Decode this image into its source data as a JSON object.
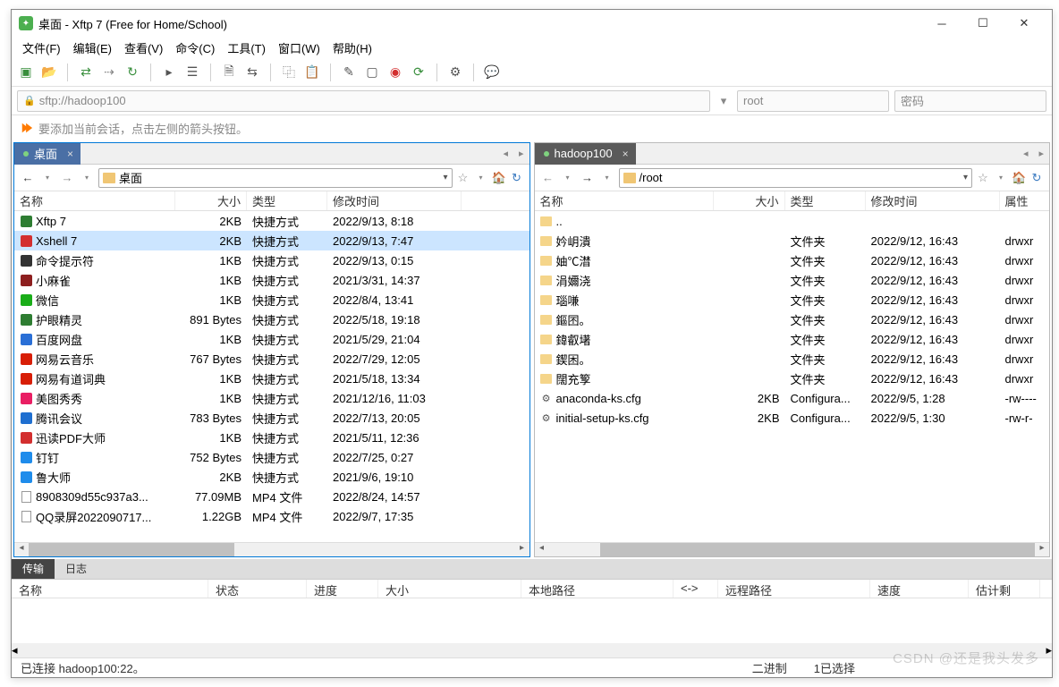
{
  "title": "桌面 - Xftp 7 (Free for Home/School)",
  "menus": [
    "文件(F)",
    "编辑(E)",
    "查看(V)",
    "命令(C)",
    "工具(T)",
    "窗口(W)",
    "帮助(H)"
  ],
  "address": {
    "url": "sftp://hadoop100",
    "user": "root",
    "pass_placeholder": "密码"
  },
  "hint": "要添加当前会话，点击左侧的箭头按钮。",
  "left": {
    "tab": "桌面",
    "path": "桌面",
    "columns": [
      "名称",
      "大小",
      "类型",
      "修改时间"
    ],
    "rows": [
      {
        "name": "Xftp 7",
        "size": "2KB",
        "type": "快捷方式",
        "date": "2022/9/13, 8:18",
        "ico": "app",
        "c": "#2e7d32"
      },
      {
        "name": "Xshell 7",
        "size": "2KB",
        "type": "快捷方式",
        "date": "2022/9/13, 7:47",
        "ico": "app",
        "c": "#d32f2f",
        "sel": true
      },
      {
        "name": "命令提示符",
        "size": "1KB",
        "type": "快捷方式",
        "date": "2022/9/13, 0:15",
        "ico": "app",
        "c": "#333"
      },
      {
        "name": "小麻雀",
        "size": "1KB",
        "type": "快捷方式",
        "date": "2021/3/31, 14:37",
        "ico": "app",
        "c": "#8d1f1f"
      },
      {
        "name": "微信",
        "size": "1KB",
        "type": "快捷方式",
        "date": "2022/8/4, 13:41",
        "ico": "app",
        "c": "#1aad19"
      },
      {
        "name": "护眼精灵",
        "size": "891 Bytes",
        "type": "快捷方式",
        "date": "2022/5/18, 19:18",
        "ico": "app",
        "c": "#2e7d32"
      },
      {
        "name": "百度网盘",
        "size": "1KB",
        "type": "快捷方式",
        "date": "2021/5/29, 21:04",
        "ico": "app",
        "c": "#2a6fd6"
      },
      {
        "name": "网易云音乐",
        "size": "767 Bytes",
        "type": "快捷方式",
        "date": "2022/7/29, 12:05",
        "ico": "app",
        "c": "#d81e06"
      },
      {
        "name": "网易有道词典",
        "size": "1KB",
        "type": "快捷方式",
        "date": "2021/5/18, 13:34",
        "ico": "app",
        "c": "#d81e06"
      },
      {
        "name": "美图秀秀",
        "size": "1KB",
        "type": "快捷方式",
        "date": "2021/12/16, 11:03",
        "ico": "app",
        "c": "#e91e63"
      },
      {
        "name": "腾讯会议",
        "size": "783 Bytes",
        "type": "快捷方式",
        "date": "2022/7/13, 20:05",
        "ico": "app",
        "c": "#1f6fd0"
      },
      {
        "name": "迅读PDF大师",
        "size": "1KB",
        "type": "快捷方式",
        "date": "2021/5/11, 12:36",
        "ico": "app",
        "c": "#d32f2f"
      },
      {
        "name": "钉钉",
        "size": "752 Bytes",
        "type": "快捷方式",
        "date": "2022/7/25, 0:27",
        "ico": "app",
        "c": "#1f8ceb"
      },
      {
        "name": "鲁大师",
        "size": "2KB",
        "type": "快捷方式",
        "date": "2021/9/6, 19:10",
        "ico": "app",
        "c": "#1f8ceb"
      },
      {
        "name": "8908309d55c937a3...",
        "size": "77.09MB",
        "type": "MP4 文件",
        "date": "2022/8/24, 14:57",
        "ico": "file",
        "c": "#4a90d9"
      },
      {
        "name": "QQ录屏2022090717...",
        "size": "1.22GB",
        "type": "MP4 文件",
        "date": "2022/9/7, 17:35",
        "ico": "file",
        "c": "#4a90d9"
      }
    ]
  },
  "right": {
    "tab": "hadoop100",
    "path": "/root",
    "columns": [
      "名称",
      "大小",
      "类型",
      "修改时间",
      "属性"
    ],
    "rows": [
      {
        "name": "..",
        "size": "",
        "type": "",
        "date": "",
        "attr": "",
        "ico": "folder"
      },
      {
        "name": "妗岄潰",
        "size": "",
        "type": "文件夹",
        "date": "2022/9/12, 16:43",
        "attr": "drwxr",
        "ico": "folder"
      },
      {
        "name": "妯℃澘",
        "size": "",
        "type": "文件夹",
        "date": "2022/9/12, 16:43",
        "attr": "drwxr",
        "ico": "folder"
      },
      {
        "name": "涓嬭浇",
        "size": "",
        "type": "文件夹",
        "date": "2022/9/12, 16:43",
        "attr": "drwxr",
        "ico": "folder"
      },
      {
        "name": "瑙嗛",
        "size": "",
        "type": "文件夹",
        "date": "2022/9/12, 16:43",
        "attr": "drwxr",
        "ico": "folder"
      },
      {
        "name": "鏂囨。",
        "size": "",
        "type": "文件夹",
        "date": "2022/9/12, 16:43",
        "attr": "drwxr",
        "ico": "folder"
      },
      {
        "name": "鍏叡墸",
        "size": "",
        "type": "文件夹",
        "date": "2022/9/12, 16:43",
        "attr": "drwxr",
        "ico": "folder"
      },
      {
        "name": "鍥困。",
        "size": "",
        "type": "文件夹",
        "date": "2022/9/12, 16:43",
        "attr": "drwxr",
        "ico": "folder"
      },
      {
        "name": "闊充箰",
        "size": "",
        "type": "文件夹",
        "date": "2022/9/12, 16:43",
        "attr": "drwxr",
        "ico": "folder"
      },
      {
        "name": "anaconda-ks.cfg",
        "size": "2KB",
        "type": "Configura...",
        "date": "2022/9/5, 1:28",
        "attr": "-rw----",
        "ico": "cfg"
      },
      {
        "name": "initial-setup-ks.cfg",
        "size": "2KB",
        "type": "Configura...",
        "date": "2022/9/5, 1:30",
        "attr": "-rw-r-",
        "ico": "cfg"
      }
    ]
  },
  "bottom": {
    "tabs": [
      "传输",
      "日志"
    ],
    "columns": [
      "名称",
      "状态",
      "进度",
      "大小",
      "本地路径",
      "<->",
      "远程路径",
      "速度",
      "估计剩"
    ]
  },
  "status": {
    "conn": "已连接 hadoop100:22。",
    "mode": "二进制",
    "sel": "1已选择"
  },
  "watermark": "CSDN @还是我头发多"
}
